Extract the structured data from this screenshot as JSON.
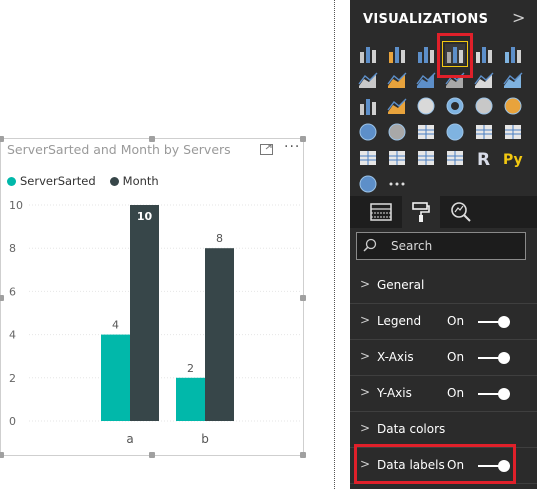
{
  "visual": {
    "title": "ServerSarted and Month by Servers",
    "more": "···",
    "legend": [
      {
        "name": "ServerSarted",
        "color": "#01B8AA"
      },
      {
        "name": "Month",
        "color": "#374649"
      }
    ]
  },
  "chart_data": {
    "type": "bar",
    "categories": [
      "a",
      "b"
    ],
    "series": [
      {
        "name": "ServerSarted",
        "values": [
          4,
          2
        ],
        "color": "#01B8AA"
      },
      {
        "name": "Month",
        "values": [
          10,
          8
        ],
        "color": "#374649"
      }
    ],
    "yticks": [
      0,
      2,
      4,
      6,
      8,
      10
    ],
    "ylim": [
      0,
      10
    ],
    "grid": true,
    "legend_position": "top-left",
    "data_labels": true,
    "bold_labels": [
      "10"
    ]
  },
  "pane": {
    "title": "VISUALIZATIONS",
    "chevron": ">",
    "icons": [
      "stacked-bar-chart-icon",
      "stacked-column-chart-icon",
      "clustered-bar-chart-icon",
      "clustered-column-chart-icon",
      "100-percent-bar-chart-icon",
      "100-percent-column-chart-icon",
      "line-chart-icon",
      "area-chart-icon",
      "stacked-area-chart-icon",
      "line-and-column-chart-icon",
      "line-and-clustered-column-chart-icon",
      "ribbon-chart-icon",
      "waterfall-chart-icon",
      "scatter-chart-icon",
      "pie-chart-icon",
      "donut-chart-icon",
      "treemap-icon",
      "map-icon",
      "filled-map-icon",
      "shape-map-icon",
      "funnel-icon",
      "gauge-icon",
      "card-icon",
      "multi-row-card-icon",
      "kpi-icon",
      "slicer-icon",
      "table-icon",
      "matrix-icon",
      "r-visual-icon",
      "python-visual-icon",
      "globe-icon",
      "more-visuals-icon"
    ],
    "selected_icon": "clustered-column-chart-icon",
    "search_placeholder": "Search",
    "sections": [
      {
        "name": "General",
        "state": "",
        "toggle": false
      },
      {
        "name": "Legend",
        "state": "On",
        "toggle": true
      },
      {
        "name": "X-Axis",
        "state": "On",
        "toggle": true
      },
      {
        "name": "Y-Axis",
        "state": "On",
        "toggle": true
      },
      {
        "name": "Data colors",
        "state": "",
        "toggle": false
      },
      {
        "name": "Data labels",
        "state": "On",
        "toggle": true
      }
    ],
    "highlight_color": "#E0202A",
    "accent_color": "#F2C811"
  }
}
